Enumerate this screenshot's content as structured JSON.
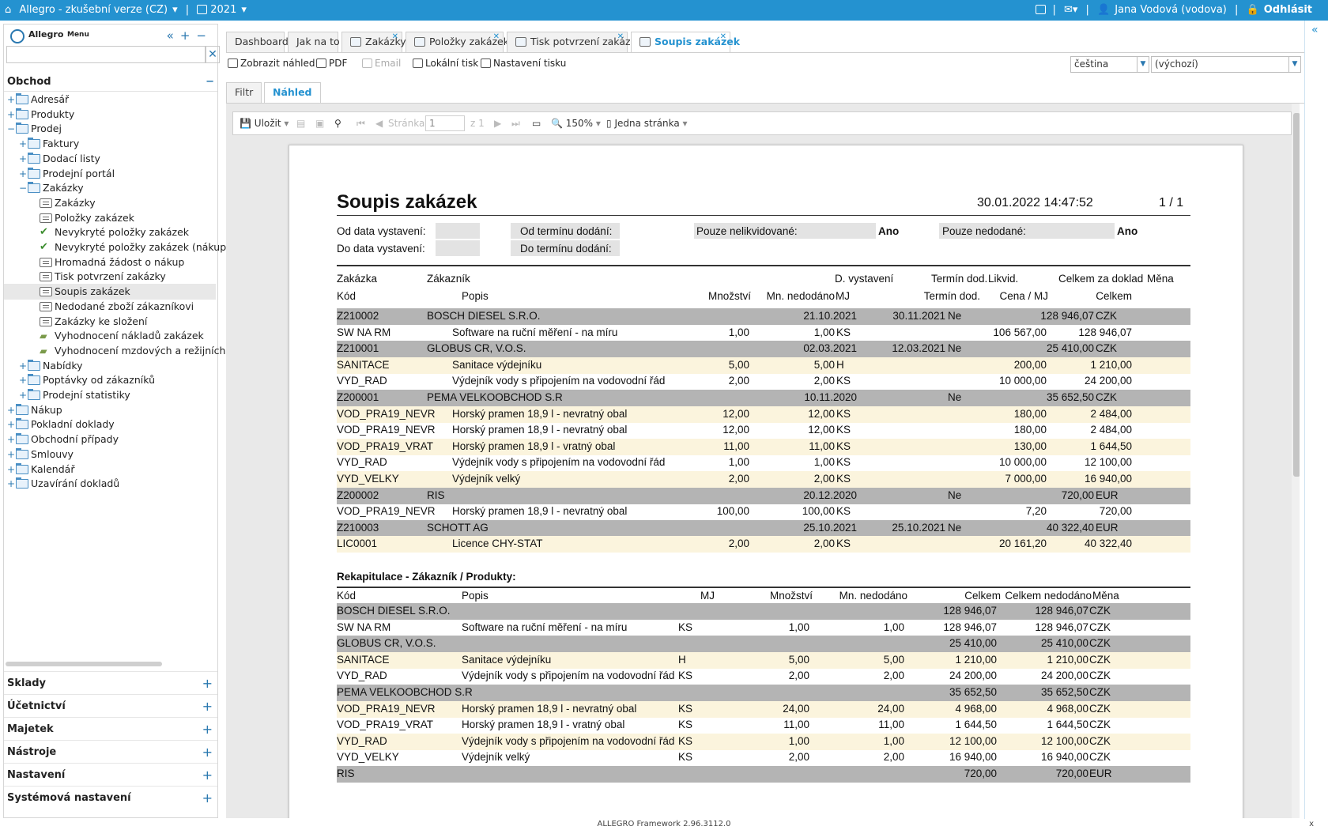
{
  "topbar": {
    "app": "Allegro - zkušební verze (CZ)",
    "year": "2021",
    "user": "Jana Vodová (vodova)",
    "logout": "Odhlásit",
    "sep": "|"
  },
  "sidebar": {
    "title": "Allegro",
    "menu": "Menu",
    "section": "Obchod",
    "tree": [
      {
        "label": "Adresář",
        "level": 0,
        "pm": "+",
        "icon": "folder"
      },
      {
        "label": "Produkty",
        "level": 0,
        "pm": "+",
        "icon": "folder"
      },
      {
        "label": "Prodej",
        "level": 0,
        "pm": "−",
        "icon": "folder"
      },
      {
        "label": "Faktury",
        "level": 1,
        "pm": "+",
        "icon": "folder"
      },
      {
        "label": "Dodací listy",
        "level": 1,
        "pm": "+",
        "icon": "folder"
      },
      {
        "label": "Prodejní portál",
        "level": 1,
        "pm": "+",
        "icon": "folder"
      },
      {
        "label": "Zakázky",
        "level": 1,
        "pm": "−",
        "icon": "folder"
      },
      {
        "label": "Zakázky",
        "level": 2,
        "pm": "",
        "icon": "doc"
      },
      {
        "label": "Položky zakázek",
        "level": 2,
        "pm": "",
        "icon": "doc"
      },
      {
        "label": "Nevykryté položky zakázek",
        "level": 2,
        "pm": "",
        "icon": "check"
      },
      {
        "label": "Nevykryté položky zakázek (nákup)",
        "level": 2,
        "pm": "",
        "icon": "check"
      },
      {
        "label": "Hromadná žádost o nákup",
        "level": 2,
        "pm": "",
        "icon": "doc"
      },
      {
        "label": "Tisk potvrzení zakázky",
        "level": 2,
        "pm": "",
        "icon": "doc"
      },
      {
        "label": "Soupis zakázek",
        "level": 2,
        "pm": "",
        "icon": "doc",
        "selected": true
      },
      {
        "label": "Nedodané zboží zákazníkovi",
        "level": 2,
        "pm": "",
        "icon": "doc"
      },
      {
        "label": "Zakázky ke složení",
        "level": 2,
        "pm": "",
        "icon": "doc"
      },
      {
        "label": "Vyhodnocení nákladů zakázek",
        "level": 2,
        "pm": "",
        "icon": "money"
      },
      {
        "label": "Vyhodnocení mzdových a režijních",
        "level": 2,
        "pm": "",
        "icon": "money"
      },
      {
        "label": "Nabídky",
        "level": 1,
        "pm": "+",
        "icon": "folder"
      },
      {
        "label": "Poptávky od zákazníků",
        "level": 1,
        "pm": "+",
        "icon": "folder"
      },
      {
        "label": "Prodejní statistiky",
        "level": 1,
        "pm": "+",
        "icon": "folder"
      },
      {
        "label": "Nákup",
        "level": 0,
        "pm": "+",
        "icon": "folder"
      },
      {
        "label": "Pokladní doklady",
        "level": 0,
        "pm": "+",
        "icon": "folder"
      },
      {
        "label": "Obchodní případy",
        "level": 0,
        "pm": "+",
        "icon": "folder"
      },
      {
        "label": "Smlouvy",
        "level": 0,
        "pm": "+",
        "icon": "folder"
      },
      {
        "label": "Kalendář",
        "level": 0,
        "pm": "+",
        "icon": "folder"
      },
      {
        "label": "Uzavírání dokladů",
        "level": 0,
        "pm": "+",
        "icon": "folder"
      }
    ],
    "sections": [
      "Sklady",
      "Účetnictví",
      "Majetek",
      "Nástroje",
      "Nastavení",
      "Systémová nastavení"
    ]
  },
  "tabs": [
    {
      "label": "Dashboard",
      "closable": false,
      "icon": false
    },
    {
      "label": "Jak na to",
      "closable": false,
      "icon": false
    },
    {
      "label": "Zakázky",
      "closable": true,
      "icon": true
    },
    {
      "label": "Položky zakázek",
      "closable": true,
      "icon": true
    },
    {
      "label": "Tisk potvrzení zakázky",
      "closable": true,
      "icon": true
    },
    {
      "label": "Soupis zakázek",
      "closable": true,
      "icon": true,
      "active": true
    }
  ],
  "toolbar": {
    "preview": "Zobrazit náhled",
    "pdf": "PDF",
    "email": "Email",
    "local_print": "Lokální tisk",
    "print_settings": "Nastavení tisku",
    "language": "čeština",
    "template": "(výchozí)"
  },
  "subtabs": {
    "filter": "Filtr",
    "preview": "Náhled"
  },
  "viewer": {
    "save": "Uložit",
    "page_label": "Stránka",
    "page": "1",
    "of": "z 1",
    "zoom": "150%",
    "mode": "Jedna stránka"
  },
  "report": {
    "title": "Soupis zakázek",
    "datetime": "30.01.2022 14:47:52",
    "pages": "1 / 1",
    "filters": {
      "od_data": "Od data vystavení:",
      "do_data": "Do data vystavení:",
      "od_terminu": "Od termínu dodání:",
      "do_terminu": "Do termínu dodání:",
      "nelikv": "Pouze nelikvidované:",
      "nelikv_val": "Ano",
      "nedodane": "Pouze nedodané:",
      "nedodane_val": "Ano"
    },
    "head1": {
      "zakazka": "Zakázka",
      "zakaznik": "Zákazník",
      "d_vyst": "D. vystavení",
      "termin": "Termín dod.",
      "likvid": "Likvid.",
      "celkem_doklad": "Celkem za doklad",
      "mena": "Měna"
    },
    "head2": {
      "kod": "Kód",
      "popis": "Popis",
      "mnozstvi": "Množství",
      "nedodano": "Mn. nedodáno",
      "mj": "MJ",
      "termin": "Termín dod.",
      "cena": "Cena / MJ",
      "celkem": "Celkem"
    },
    "rows": [
      {
        "t": "g",
        "code": "Z210002",
        "name": "BOSCH DIESEL S.R.O.",
        "dvyst": "21.10.2021",
        "term": "30.11.2021",
        "likv": "Ne",
        "total": "128 946,07",
        "cur": "CZK"
      },
      {
        "t": "w",
        "code": "SW NA RM",
        "desc": "Software na ruční měření - na míru",
        "qty": "1,00",
        "ned": "1,00",
        "mj": "KS",
        "price": "106 567,00",
        "sum": "128 946,07"
      },
      {
        "t": "g",
        "code": "Z210001",
        "name": "GLOBUS CR, V.O.S.",
        "dvyst": "02.03.2021",
        "term": "12.03.2021",
        "likv": "Ne",
        "total": "25 410,00",
        "cur": "CZK"
      },
      {
        "t": "b",
        "code": "SANITACE",
        "desc": "Sanitace výdejníku",
        "qty": "5,00",
        "ned": "5,00",
        "mj": "H",
        "price": "200,00",
        "sum": "1 210,00"
      },
      {
        "t": "w",
        "code": "VYD_RAD",
        "desc": "Výdejník vody s připojením na vodovodní řád",
        "qty": "2,00",
        "ned": "2,00",
        "mj": "KS",
        "price": "10 000,00",
        "sum": "24 200,00"
      },
      {
        "t": "g",
        "code": "Z200001",
        "name": "PEMA VELKOOBCHOD S.R",
        "dvyst": "10.11.2020",
        "term": "",
        "likv": "Ne",
        "total": "35 652,50",
        "cur": "CZK"
      },
      {
        "t": "b",
        "code": "VOD_PRA19_NEVR",
        "desc": "Horský pramen 18,9 l - nevratný obal",
        "qty": "12,00",
        "ned": "12,00",
        "mj": "KS",
        "price": "180,00",
        "sum": "2 484,00"
      },
      {
        "t": "w",
        "code": "VOD_PRA19_NEVR",
        "desc": "Horský pramen 18,9 l - nevratný obal",
        "qty": "12,00",
        "ned": "12,00",
        "mj": "KS",
        "price": "180,00",
        "sum": "2 484,00"
      },
      {
        "t": "b",
        "code": "VOD_PRA19_VRAT",
        "desc": "Horský pramen 18,9 l - vratný obal",
        "qty": "11,00",
        "ned": "11,00",
        "mj": "KS",
        "price": "130,00",
        "sum": "1 644,50"
      },
      {
        "t": "w",
        "code": "VYD_RAD",
        "desc": "Výdejník vody s připojením na vodovodní řád",
        "qty": "1,00",
        "ned": "1,00",
        "mj": "KS",
        "price": "10 000,00",
        "sum": "12 100,00"
      },
      {
        "t": "b",
        "code": "VYD_VELKY",
        "desc": "Výdejník velký",
        "qty": "2,00",
        "ned": "2,00",
        "mj": "KS",
        "price": "7 000,00",
        "sum": "16 940,00"
      },
      {
        "t": "g",
        "code": "Z200002",
        "name": "RIS",
        "dvyst": "20.12.2020",
        "term": "",
        "likv": "Ne",
        "total": "720,00",
        "cur": "EUR"
      },
      {
        "t": "w",
        "code": "VOD_PRA19_NEVR",
        "desc": "Horský pramen 18,9 l - nevratný obal",
        "qty": "100,00",
        "ned": "100,00",
        "mj": "KS",
        "price": "7,20",
        "sum": "720,00"
      },
      {
        "t": "g",
        "code": "Z210003",
        "name": "SCHOTT AG",
        "dvyst": "25.10.2021",
        "term": "25.10.2021",
        "likv": "Ne",
        "total": "40 322,40",
        "cur": "EUR"
      },
      {
        "t": "b",
        "code": "LIC0001",
        "desc": "Licence CHY-STAT",
        "qty": "2,00",
        "ned": "2,00",
        "mj": "KS",
        "price": "20 161,20",
        "sum": "40 322,40"
      }
    ],
    "recap_title": "Rekapitulace - Zákazník / Produkty:",
    "recap_head": {
      "kod": "Kód",
      "popis": "Popis",
      "mj": "MJ",
      "mnozstvi": "Množství",
      "nedodano": "Mn. nedodáno",
      "celkem": "Celkem",
      "celkem_ned": "Celkem nedodáno",
      "mena": "Měna"
    },
    "recap": [
      {
        "t": "g",
        "name": "BOSCH DIESEL S.R.O.",
        "total": "128 946,07",
        "tned": "128 946,07",
        "cur": "CZK"
      },
      {
        "t": "w",
        "code": "SW NA RM",
        "desc": "Software na ruční měření - na míru",
        "mj": "KS",
        "qty": "1,00",
        "ned": "1,00",
        "total": "128 946,07",
        "tned": "128 946,07",
        "cur": "CZK"
      },
      {
        "t": "g",
        "name": "GLOBUS CR, V.O.S.",
        "total": "25 410,00",
        "tned": "25 410,00",
        "cur": "CZK"
      },
      {
        "t": "b",
        "code": "SANITACE",
        "desc": "Sanitace výdejníku",
        "mj": "H",
        "qty": "5,00",
        "ned": "5,00",
        "total": "1 210,00",
        "tned": "1 210,00",
        "cur": "CZK"
      },
      {
        "t": "w",
        "code": "VYD_RAD",
        "desc": "Výdejník vody s připojením na vodovodní řád",
        "mj": "KS",
        "qty": "2,00",
        "ned": "2,00",
        "total": "24 200,00",
        "tned": "24 200,00",
        "cur": "CZK"
      },
      {
        "t": "g",
        "name": "PEMA VELKOOBCHOD S.R",
        "total": "35 652,50",
        "tned": "35 652,50",
        "cur": "CZK"
      },
      {
        "t": "b",
        "code": "VOD_PRA19_NEVR",
        "desc": "Horský pramen 18,9 l - nevratný obal",
        "mj": "KS",
        "qty": "24,00",
        "ned": "24,00",
        "total": "4 968,00",
        "tned": "4 968,00",
        "cur": "CZK"
      },
      {
        "t": "w",
        "code": "VOD_PRA19_VRAT",
        "desc": "Horský pramen 18,9 l - vratný obal",
        "mj": "KS",
        "qty": "11,00",
        "ned": "11,00",
        "total": "1 644,50",
        "tned": "1 644,50",
        "cur": "CZK"
      },
      {
        "t": "b",
        "code": "VYD_RAD",
        "desc": "Výdejník vody s připojením na vodovodní řád",
        "mj": "KS",
        "qty": "1,00",
        "ned": "1,00",
        "total": "12 100,00",
        "tned": "12 100,00",
        "cur": "CZK"
      },
      {
        "t": "w",
        "code": "VYD_VELKY",
        "desc": "Výdejník velký",
        "mj": "KS",
        "qty": "2,00",
        "ned": "2,00",
        "total": "16 940,00",
        "tned": "16 940,00",
        "cur": "CZK"
      },
      {
        "t": "g",
        "name": "RIS",
        "total": "720,00",
        "tned": "720,00",
        "cur": "EUR"
      }
    ]
  },
  "footer": {
    "text": "ALLEGRO Framework 2.96.3112.0",
    "close": "x"
  },
  "colors": {
    "accent": "#2492d0",
    "gray_row": "#b4b4b4",
    "beige_row": "#fbf4dd"
  }
}
